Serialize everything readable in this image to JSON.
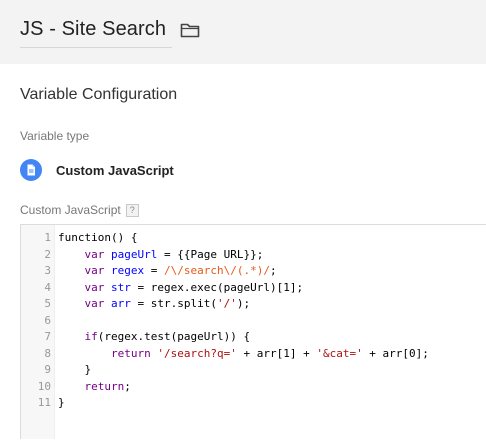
{
  "header": {
    "title": "JS - Site Search"
  },
  "icons": {
    "folder": "folder-icon",
    "variable_type": "document-icon",
    "help": "help-icon"
  },
  "colors": {
    "header_bg": "#f3f3f3",
    "accent": "#4285f4",
    "keyword": "#770088",
    "variable": "#0000ff",
    "string": "#aa1111",
    "regex": "#e45b1b"
  },
  "config": {
    "section_title": "Variable Configuration",
    "variable_type_label": "Variable type",
    "variable_type_value": "Custom JavaScript",
    "custom_js_label": "Custom JavaScript",
    "help_glyph": "?"
  },
  "editor": {
    "line_numbers": [
      "1",
      "2",
      "3",
      "4",
      "5",
      "6",
      "7",
      "8",
      "9",
      "10",
      "11"
    ],
    "lines": [
      [
        {
          "t": "plain",
          "v": "function() {"
        }
      ],
      [
        {
          "t": "plain",
          "v": "    "
        },
        {
          "t": "kw",
          "v": "var"
        },
        {
          "t": "plain",
          "v": " "
        },
        {
          "t": "def",
          "v": "pageUrl"
        },
        {
          "t": "plain",
          "v": " = {{Page URL}};"
        }
      ],
      [
        {
          "t": "plain",
          "v": "    "
        },
        {
          "t": "kw",
          "v": "var"
        },
        {
          "t": "plain",
          "v": " "
        },
        {
          "t": "def",
          "v": "regex"
        },
        {
          "t": "plain",
          "v": " = "
        },
        {
          "t": "rx",
          "v": "/\\/search\\/(.*)/"
        },
        {
          "t": "plain",
          "v": ";"
        }
      ],
      [
        {
          "t": "plain",
          "v": "    "
        },
        {
          "t": "kw",
          "v": "var"
        },
        {
          "t": "plain",
          "v": " "
        },
        {
          "t": "def",
          "v": "str"
        },
        {
          "t": "plain",
          "v": " = regex.exec(pageUrl)[1];"
        }
      ],
      [
        {
          "t": "plain",
          "v": "    "
        },
        {
          "t": "kw",
          "v": "var"
        },
        {
          "t": "plain",
          "v": " "
        },
        {
          "t": "def",
          "v": "arr"
        },
        {
          "t": "plain",
          "v": " = str.split("
        },
        {
          "t": "str",
          "v": "'/'"
        },
        {
          "t": "plain",
          "v": ");"
        }
      ],
      [
        {
          "t": "plain",
          "v": ""
        }
      ],
      [
        {
          "t": "plain",
          "v": "    "
        },
        {
          "t": "kw",
          "v": "if"
        },
        {
          "t": "plain",
          "v": "(regex.test(pageUrl)) {"
        }
      ],
      [
        {
          "t": "plain",
          "v": "        "
        },
        {
          "t": "kw",
          "v": "return"
        },
        {
          "t": "plain",
          "v": " "
        },
        {
          "t": "str",
          "v": "'/search?q='"
        },
        {
          "t": "plain",
          "v": " + arr[1] + "
        },
        {
          "t": "str",
          "v": "'&cat='"
        },
        {
          "t": "plain",
          "v": " + arr[0];"
        }
      ],
      [
        {
          "t": "plain",
          "v": "    }"
        }
      ],
      [
        {
          "t": "plain",
          "v": "    "
        },
        {
          "t": "kw",
          "v": "return"
        },
        {
          "t": "plain",
          "v": ";"
        }
      ],
      [
        {
          "t": "plain",
          "v": "}"
        }
      ]
    ]
  }
}
